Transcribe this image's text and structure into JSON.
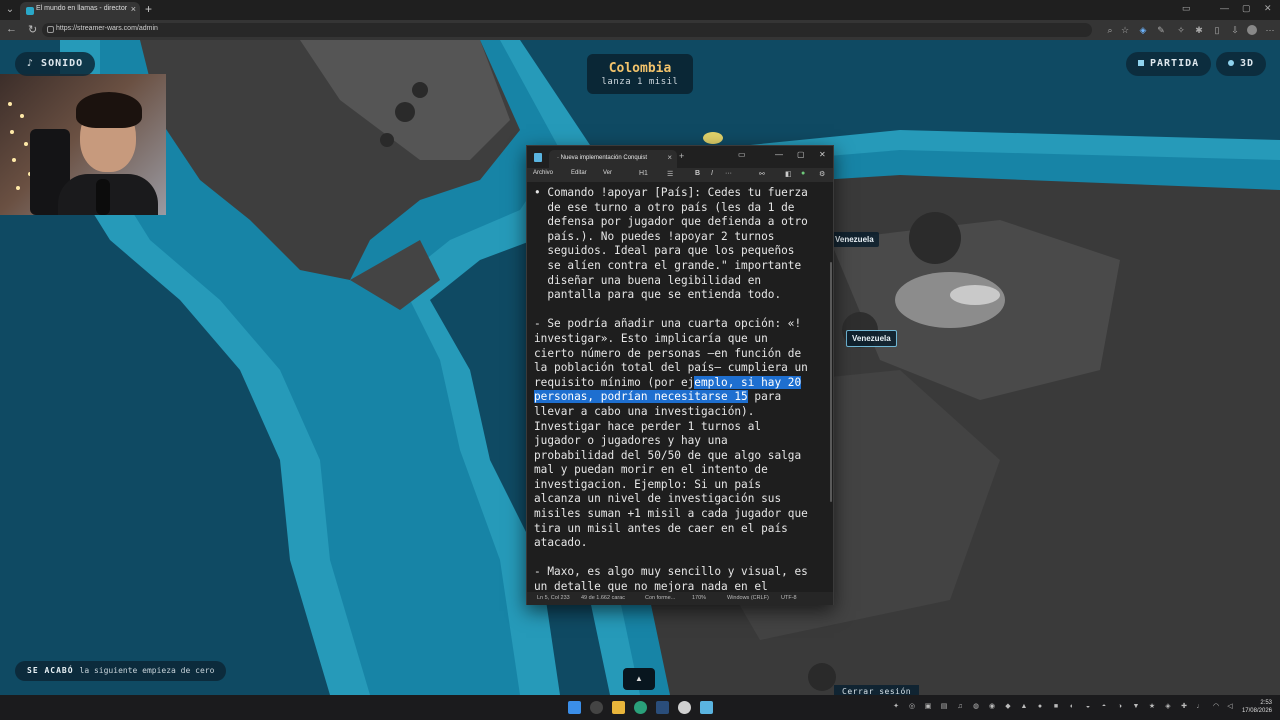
{
  "browser": {
    "tab_title": "El mundo en llamas - director",
    "url": "https://streamer-wars.com/admin",
    "new_tab_glyph": "+",
    "close_glyph": "×"
  },
  "game": {
    "sound_button": "SONIDO",
    "partida_button": "PARTIDA",
    "view_3d_button": "3D",
    "banner": {
      "country": "Colombia",
      "action": "lanza 1 misil"
    },
    "map_labels": {
      "venezuela_1": "Venezuela",
      "venezuela_2": "Venezuela"
    },
    "status_bar": {
      "label": "SE ACABÓ",
      "text": "la siguiente empieza de cero"
    },
    "up_button": "▲",
    "logout": "Cerrar sesión"
  },
  "notepad": {
    "tab_title": "· Nueva implementación Conquist",
    "menu": {
      "file": "Archivo",
      "edit": "Editar",
      "view": "Ver"
    },
    "toolbar": {
      "heading": "H1",
      "list": "☰",
      "bold": "B",
      "italic": "I",
      "more": "···"
    },
    "content": {
      "pre": "• Comando !apoyar [País]: Cedes tu fuerza\n  de ese turno a otro país (les da 1 de\n  defensa por jugador que defienda a otro\n  país.). No puedes !apoyar 2 turnos\n  seguidos. Ideal para que los pequeños\n  se alíen contra el grande.\" importante\n  diseñar una buena legibilidad en\n  pantalla para que se entienda todo.\n\n- Se podría añadir una cuarta opción: «!\ninvestigar». Esto implicaría que un\ncierto número de personas —en función de\nla población total del país— cumpliera un\nrequisito mínimo (por ej",
      "highlight_1": "emplo, si hay 20",
      "newline": "\n",
      "highlight_2": "personas, podrían necesitarse 15",
      "post": " para\nllevar a cabo una investigación).\nInvestigar hace perder 1 turnos al\njugador o jugadores y hay una\nprobabilidad del 50/50 de que algo salga\nmal y puedan morir en el intento de\ninvestigacion. Ejemplo: Si un país\nalcanza un nivel de investigación sus\nmisiles suman +1 misil a cada jugador que\ntira un misil antes de caer en el país\natacado.\n\n- Maxo, es algo muy sencillo y visual, es\nun detalle que no mejora nada en el"
    },
    "status": {
      "position": "Ln 5, Col 233",
      "chars": "49 de 1.662 carac",
      "format": "Con forme...",
      "zoom": "170%",
      "eol": "Windows (CRLF)",
      "encoding": "UTF-8"
    }
  },
  "taskbar": {
    "time": "2:53",
    "date": "17/08/2026"
  },
  "colors": {
    "ocean": "#0f4a63",
    "coast": "#2aa8c8",
    "land": "#3a3a3a",
    "banner_title": "#f2c36b",
    "selection": "#1e6fd0"
  }
}
